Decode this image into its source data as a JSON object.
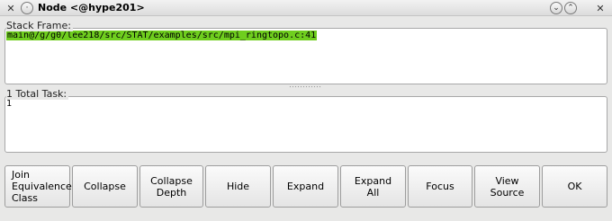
{
  "window": {
    "title": "Node <@hype201>"
  },
  "stack_frame": {
    "label": "Stack Frame:",
    "value": "main@/g/g0/lee218/src/STAT/examples/src/mpi_ringtopo.c:41"
  },
  "tasks": {
    "label": "1 Total Task:",
    "value": "1"
  },
  "buttons": [
    {
      "label": "Join\nEquivalence\nClass"
    },
    {
      "label": "Collapse"
    },
    {
      "label": "Collapse\nDepth"
    },
    {
      "label": "Hide"
    },
    {
      "label": "Expand"
    },
    {
      "label": "Expand\nAll"
    },
    {
      "label": "Focus"
    },
    {
      "label": "View\nSource"
    },
    {
      "label": "OK"
    }
  ],
  "colors": {
    "selection": "#6fce1e",
    "window_bg": "#e8e8e7"
  },
  "icons": [
    "app-x-icon",
    "window-menu-icon",
    "minimize-icon",
    "maximize-icon",
    "close-icon"
  ]
}
